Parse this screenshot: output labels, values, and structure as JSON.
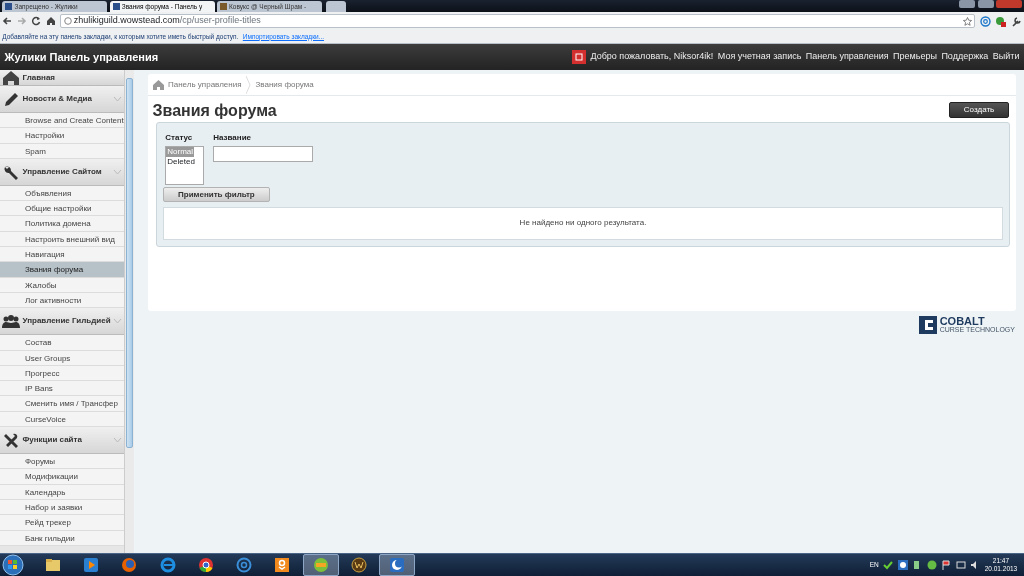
{
  "browser": {
    "tabs": [
      {
        "title": "Запрещено - Жулики",
        "selected": false
      },
      {
        "title": "Звания форума - Панель у",
        "selected": true
      },
      {
        "title": "Ковукс @ Черный Шрам -",
        "selected": false
      }
    ],
    "address": {
      "host": "zhulikiguild.wowstead.com",
      "path": "/cp/user-profile-titles"
    },
    "bookmarks_bar": {
      "hint": "Добавляйте на эту панель закладки, к которым хотите иметь быстрый доступ.",
      "link": "Импортировать закладки..."
    }
  },
  "header": {
    "site_title": "Жулики Панель управления",
    "welcome": "Добро пожаловать, Niksor4ik!",
    "links": [
      "Моя учетная запись",
      "Панель управления",
      "Премьеры",
      "Поддержка",
      "Выйти"
    ]
  },
  "sidebar": {
    "sections": [
      {
        "title": "Главная",
        "kind": "home"
      },
      {
        "title": "Новости & Медиа",
        "kind": "pencil",
        "items": [
          {
            "label": "Browse and Create Content",
            "selected": false
          },
          {
            "label": "Настройки",
            "selected": false
          },
          {
            "label": "Spam",
            "selected": false
          }
        ]
      },
      {
        "title": "Управление Сайтом",
        "kind": "wrench",
        "items": [
          {
            "label": "Объявления",
            "selected": false
          },
          {
            "label": "Общие настройки",
            "selected": false
          },
          {
            "label": "Политика домена",
            "selected": false
          },
          {
            "label": "Настроить внешний вид",
            "selected": false
          },
          {
            "label": "Навигация",
            "selected": false
          },
          {
            "label": "Звания форума",
            "selected": true
          },
          {
            "label": "Жалобы",
            "selected": false
          },
          {
            "label": "Лог активности",
            "selected": false
          }
        ]
      },
      {
        "title": "Управление Гильдией",
        "kind": "group",
        "items": [
          {
            "label": "Состав",
            "selected": false
          },
          {
            "label": "User Groups",
            "selected": false
          },
          {
            "label": "Прогресс",
            "selected": false
          },
          {
            "label": "IP Bans",
            "selected": false
          },
          {
            "label": "Сменить имя / Трансфер",
            "selected": false
          },
          {
            "label": "CurseVoice",
            "selected": false
          }
        ]
      },
      {
        "title": "Функции сайта",
        "kind": "tools",
        "items": [
          {
            "label": "Форумы",
            "selected": false
          },
          {
            "label": "Модификации",
            "selected": false
          },
          {
            "label": "Календарь",
            "selected": false
          },
          {
            "label": "Набор и заявки",
            "selected": false
          },
          {
            "label": "Рейд трекер",
            "selected": false
          },
          {
            "label": "Банк гильдии",
            "selected": false
          }
        ]
      }
    ]
  },
  "breadcrumb": [
    "Панель управления",
    "Звания форума"
  ],
  "page_title": "Звания форума",
  "create_button": "Создать",
  "filter": {
    "status_label": "Статус",
    "name_label": "Название",
    "status_options": [
      {
        "label": "Normal",
        "selected": true
      },
      {
        "label": "Deleted",
        "selected": false
      }
    ],
    "apply_button": "Применить фильтр",
    "empty_message": "Не найдено ни одного результата."
  },
  "footer_logo": {
    "name": "COBALT",
    "tagline": "CURSE TECHNOLOGY"
  },
  "taskbar": {
    "apps": [
      {
        "kind": "folder",
        "active": false
      },
      {
        "kind": "player",
        "active": false
      },
      {
        "kind": "firefox",
        "active": false
      },
      {
        "kind": "ie",
        "active": false
      },
      {
        "kind": "chrome",
        "active": false
      },
      {
        "kind": "at",
        "active": false
      },
      {
        "kind": "ok",
        "active": false
      },
      {
        "kind": "game",
        "active": true
      },
      {
        "kind": "wow",
        "active": false
      },
      {
        "kind": "curse",
        "active": true
      }
    ],
    "language": "EN",
    "time": "21:47",
    "date": "20.01.2013"
  }
}
